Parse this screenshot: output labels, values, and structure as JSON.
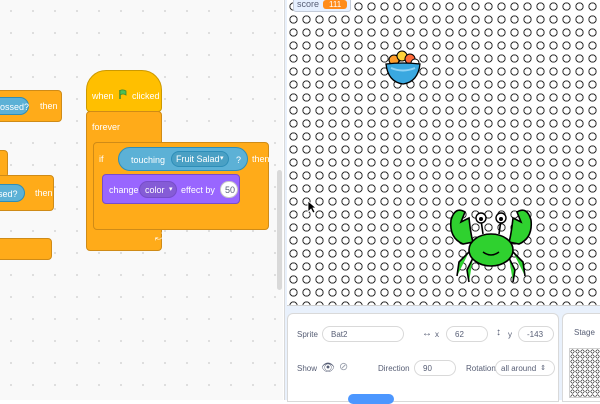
{
  "code_area": {
    "partial_block_1": "ossed?",
    "partial_block_1_then": "then",
    "partial_block_2": "sed?",
    "partial_block_2_then": "then",
    "script": {
      "hat_when": "when",
      "hat_clicked": "clicked",
      "forever": "forever",
      "if": "if",
      "touching": "touching",
      "touching_target": "Fruit Salad",
      "question_mark": "?",
      "then": "then",
      "change": "change",
      "effect_name": "color",
      "effect_by": "effect by",
      "effect_value": "50",
      "loop_arrow": "⤾"
    }
  },
  "stage": {
    "monitor_label": "score",
    "monitor_value": "111"
  },
  "sprite_info": {
    "sprite_label": "Sprite",
    "sprite_name": "Bat2",
    "x_label": "x",
    "x_value": "62",
    "y_label": "y",
    "y_value": "-143",
    "show_label": "Show",
    "direction_label": "Direction",
    "direction_value": "90",
    "rotation_label": "Rotation",
    "rotation_value": "all around"
  },
  "stage_tab": {
    "label": "Stage"
  },
  "colors": {
    "control": "#ffab19",
    "events": "#ffbf00",
    "sensing": "#5cb1d6",
    "looks": "#9966ff",
    "crab": "#2fd12f",
    "monitor_value": "#ff8c1a"
  }
}
